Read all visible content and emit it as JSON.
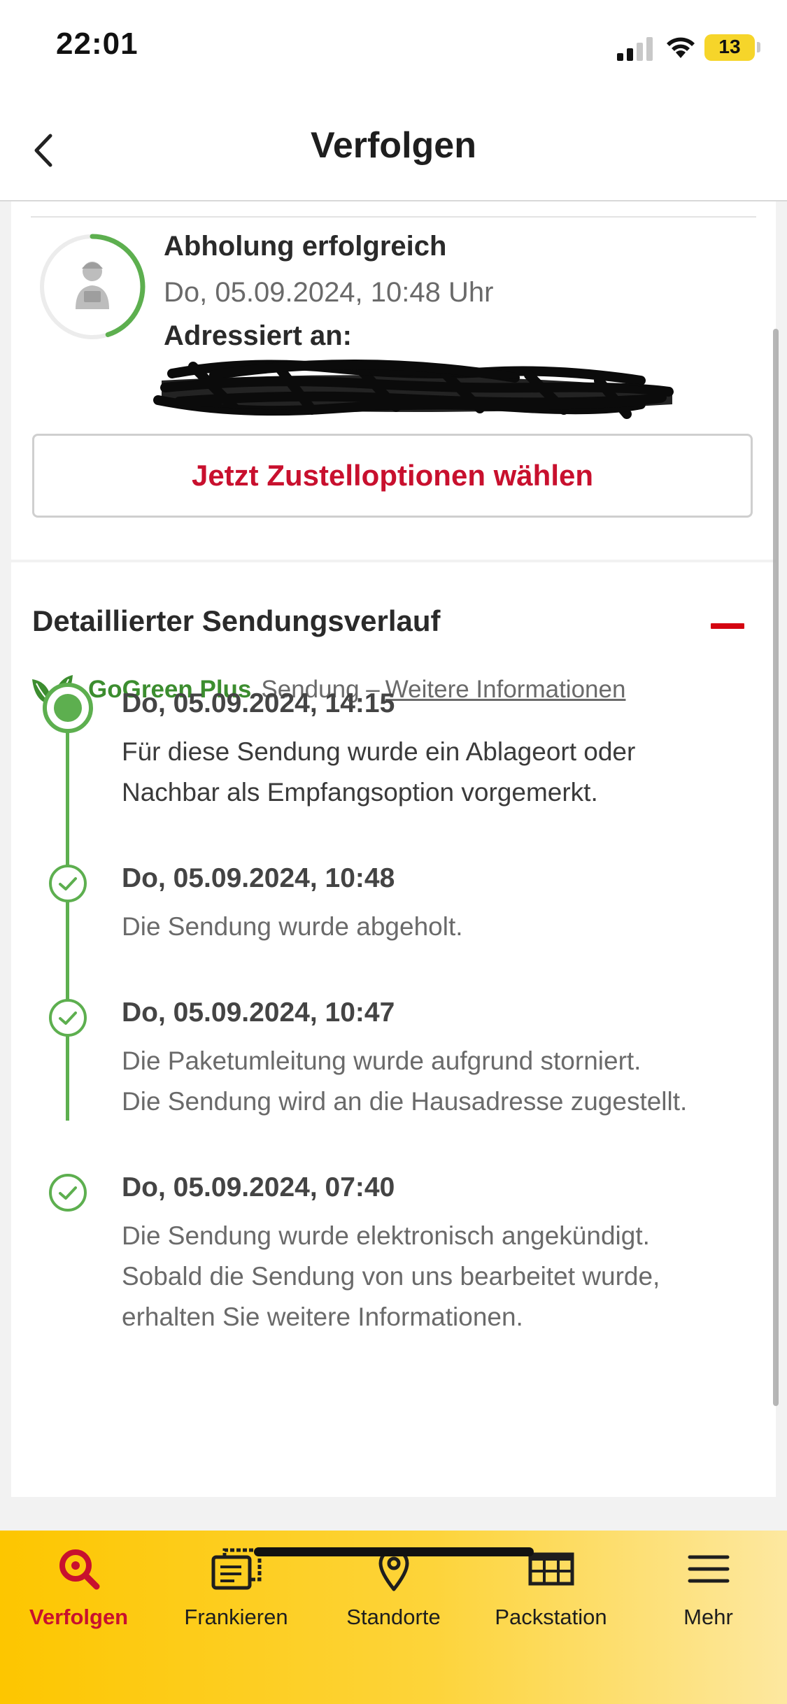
{
  "status_bar": {
    "time": "22:01",
    "battery": "13",
    "signal_icon": "cellular-signal-icon",
    "wifi_icon": "wifi-icon",
    "battery_icon": "battery-charging-icon"
  },
  "header": {
    "title": "Verfolgen",
    "back_icon": "chevron-left-icon"
  },
  "shipment": {
    "status_title": "Abholung erfolgreich",
    "status_date": "Do, 05.09.2024, 10:48 Uhr",
    "addressed_to_label": "Adressiert an:",
    "addressee": "[redacted]",
    "progress_fraction": 0.45,
    "courier_icon": "courier-avatar-icon",
    "cta_label": "Jetzt Zustelloptionen wählen"
  },
  "history": {
    "title": "Detaillierter Sendungsverlauf",
    "collapse_icon": "minus-icon",
    "gogreen": {
      "brand": "GoGreen Plus",
      "text": "Sendung –",
      "link": "Weitere Informationen"
    },
    "events": [
      {
        "date": "Do, 05.09.2024, 14:15",
        "lines": [
          "Für diese Sendung wurde ein Ablageort oder",
          "Nachbar als Empfangsoption vorgemerkt."
        ],
        "current": true
      },
      {
        "date": "Do, 05.09.2024, 10:48",
        "lines": [
          "Die Sendung wurde abgeholt."
        ],
        "current": false
      },
      {
        "date": "Do, 05.09.2024, 10:47",
        "lines": [
          "Die Paketumleitung wurde aufgrund storniert.",
          "Die Sendung wird an die Hausadresse zugestellt."
        ],
        "current": false
      },
      {
        "date": "Do, 05.09.2024, 07:40",
        "lines": [
          "Die Sendung wurde elektronisch angekündigt.",
          "Sobald die Sendung von uns bearbeitet wurde,",
          "erhalten Sie weitere Informationen."
        ],
        "current": false
      }
    ]
  },
  "tabs": [
    {
      "label": "Verfolgen",
      "icon": "search-icon",
      "active": true
    },
    {
      "label": "Frankieren",
      "icon": "stamp-icon",
      "active": false
    },
    {
      "label": "Standorte",
      "icon": "location-pin-icon",
      "active": false
    },
    {
      "label": "Packstation",
      "icon": "packstation-icon",
      "active": false
    },
    {
      "label": "Mehr",
      "icon": "menu-icon",
      "active": false
    }
  ],
  "colors": {
    "brand_red": "#c8102e",
    "brand_yellow": "#fdc600",
    "success_green": "#5daf4f"
  }
}
